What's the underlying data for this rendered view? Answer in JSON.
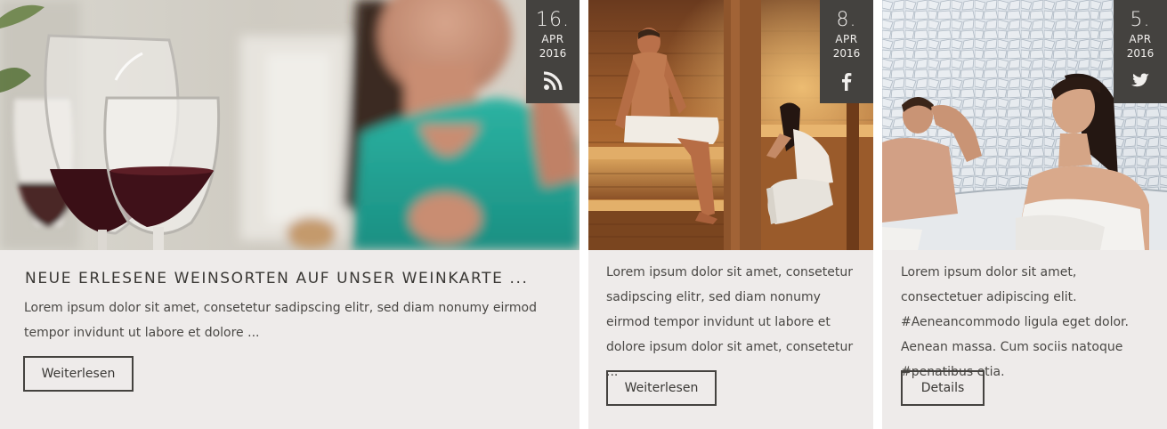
{
  "cards": [
    {
      "date": {
        "day": "16.",
        "month": "APR",
        "year": "2016"
      },
      "source_icon": "rss-icon",
      "image": "wine-glasses-restaurant-photo",
      "title": "NEUE ERLESENE WEINSORTEN AUF UNSER WEINKARTE ...",
      "excerpt": "Lorem ipsum dolor sit amet, consetetur sadipscing elitr, sed diam nonumy eirmod tempor invidunt ut labore et dolore ...",
      "button_label": "Weiterlesen"
    },
    {
      "date": {
        "day": "8.",
        "month": "APR",
        "year": "2016"
      },
      "source_icon": "facebook-icon",
      "image": "sauna-couple-photo",
      "excerpt": "Lorem ipsum dolor sit amet, consetetur sadipscing elitr, sed diam nonumy eirmod tempor invidunt ut labore et dolore ipsum dolor sit amet, consetetur ...",
      "button_label": "Weiterlesen"
    },
    {
      "date": {
        "day": "5.",
        "month": "APR",
        "year": "2016"
      },
      "source_icon": "twitter-icon",
      "image": "steam-bath-couple-photo",
      "excerpt": "Lorem ipsum dolor sit amet, consectetuer adipiscing elit. #Aeneancommodo ligula eget dolor. Aenean massa. Cum sociis natoque #penatibus etia.",
      "button_label": "Details"
    }
  ],
  "colors": {
    "card_bg": "#eeebea",
    "badge_bg": "#44423f",
    "text": "#3f3d3b"
  }
}
